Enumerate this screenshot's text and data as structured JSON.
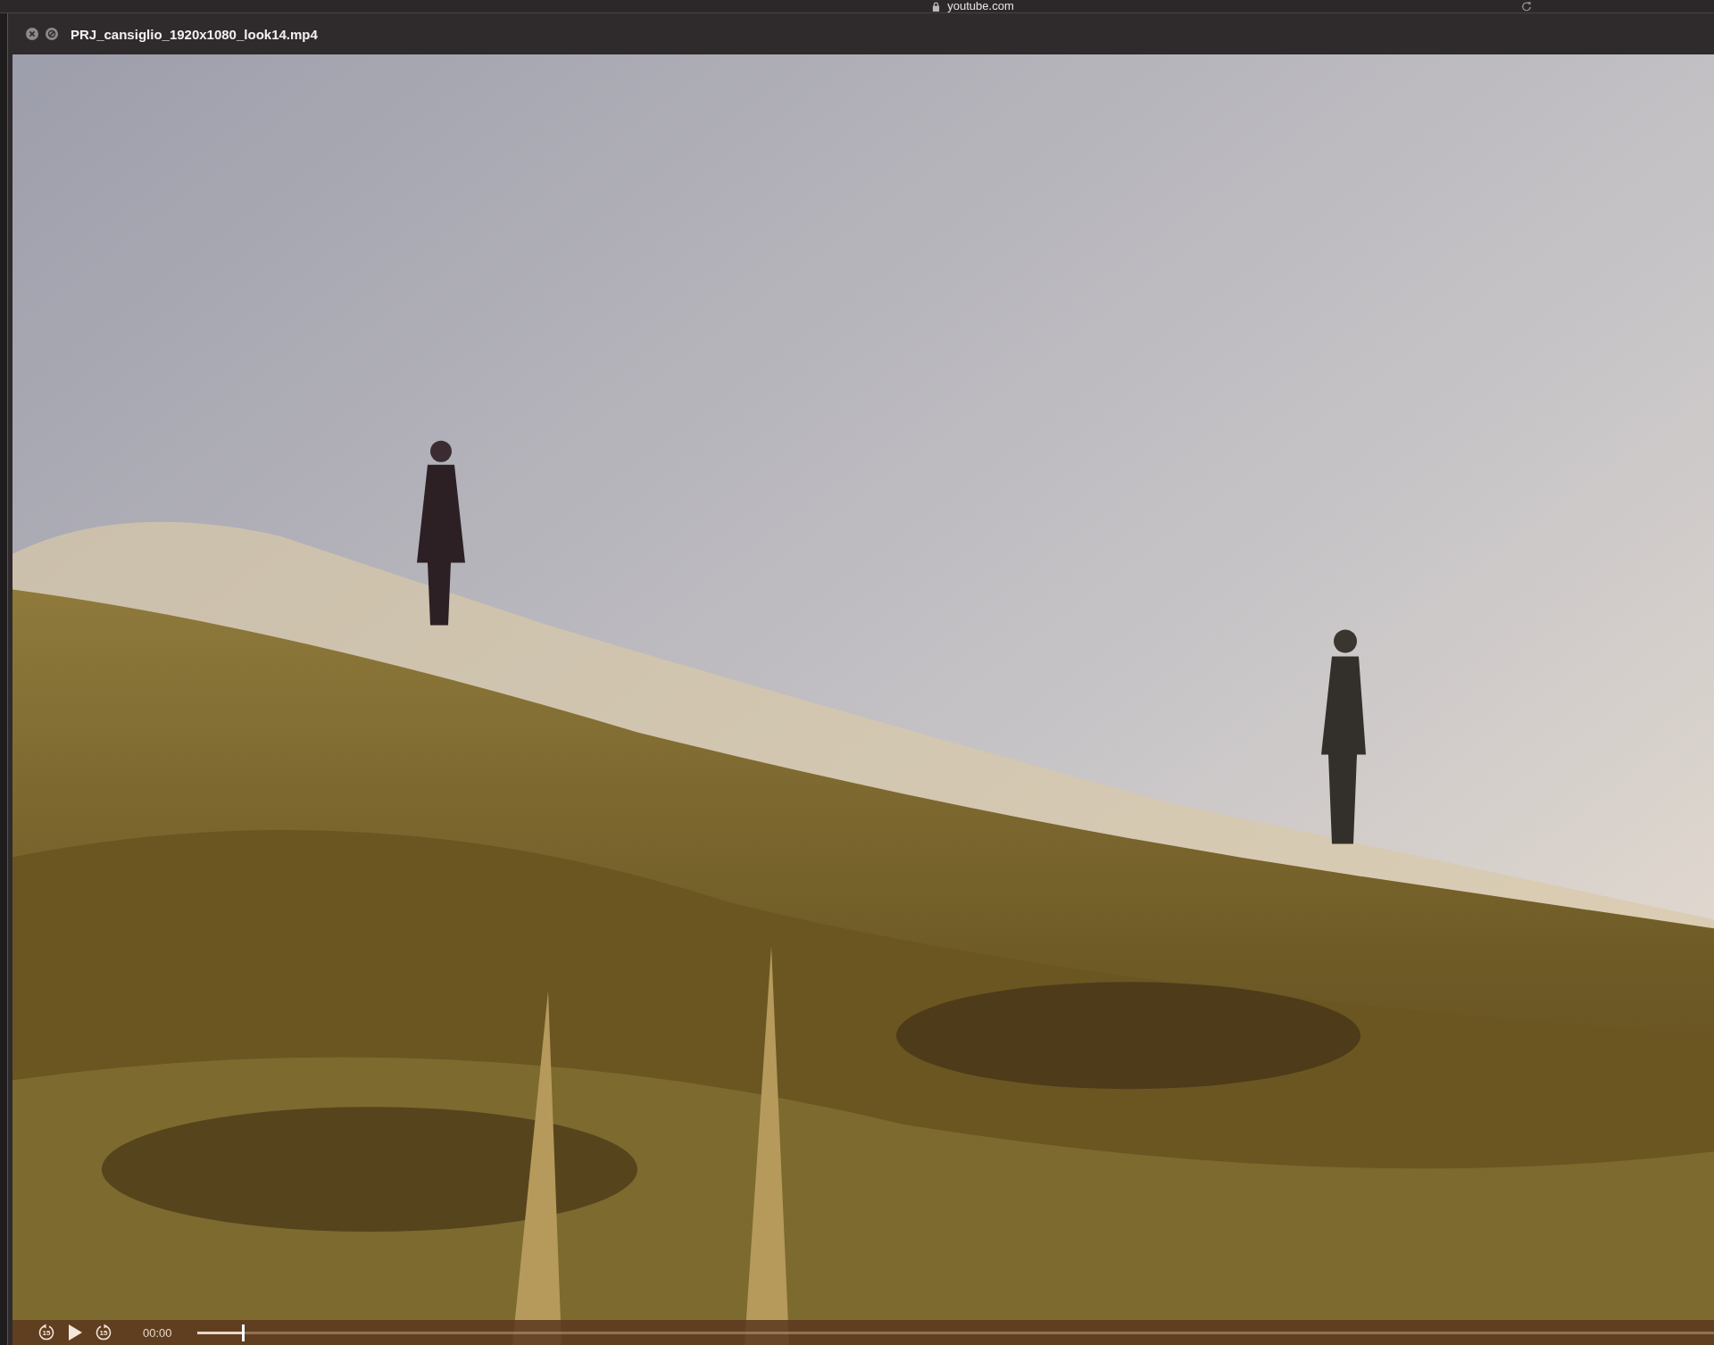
{
  "browser_bar": {
    "address": "youtube.com"
  },
  "window": {
    "title": "PRJ_cansiglio_1920x1080_look14.mp4"
  },
  "controls": {
    "skip_back": "15",
    "skip_forward": "15",
    "time": "00:00",
    "progress": {
      "level": 0.03
    }
  }
}
